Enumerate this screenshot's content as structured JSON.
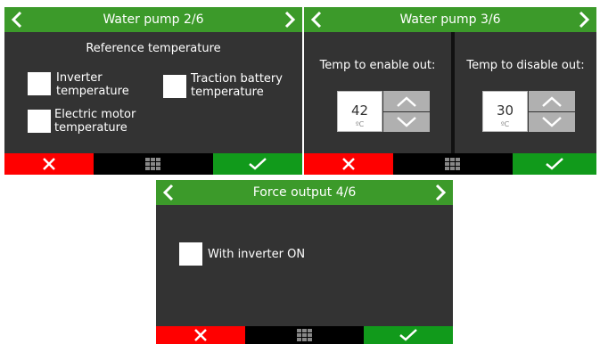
{
  "screen1": {
    "title": "Water pump 2/6",
    "heading": "Reference temperature",
    "options": [
      {
        "label_line1": "Inverter",
        "label_line2": "temperature",
        "checked": false
      },
      {
        "label_line1": "Traction battery",
        "label_line2": "temperature",
        "checked": false
      },
      {
        "label_line1": "Electric motor",
        "label_line2": "temperature",
        "checked": false
      }
    ]
  },
  "screen2": {
    "title": "Water pump 3/6",
    "enable_label": "Temp to enable out:",
    "enable_value": "42",
    "disable_label": "Temp to disable out:",
    "disable_value": "30",
    "unit": "ºC"
  },
  "screen3": {
    "title": "Force output 4/6",
    "option_label": "With inverter ON",
    "checked": false
  },
  "colors": {
    "header_green": "#3c9a2a",
    "panel_gray": "#333333",
    "cancel_red": "#ff0000",
    "confirm_green": "#119a1b",
    "stepper_gray": "#b0b0b0"
  },
  "icons": {
    "prev": "chevron-left-icon",
    "next": "chevron-right-icon",
    "cancel": "close-icon",
    "menu": "grid-menu-icon",
    "confirm": "check-icon",
    "increment": "chevron-up-icon",
    "decrement": "chevron-down-icon"
  }
}
